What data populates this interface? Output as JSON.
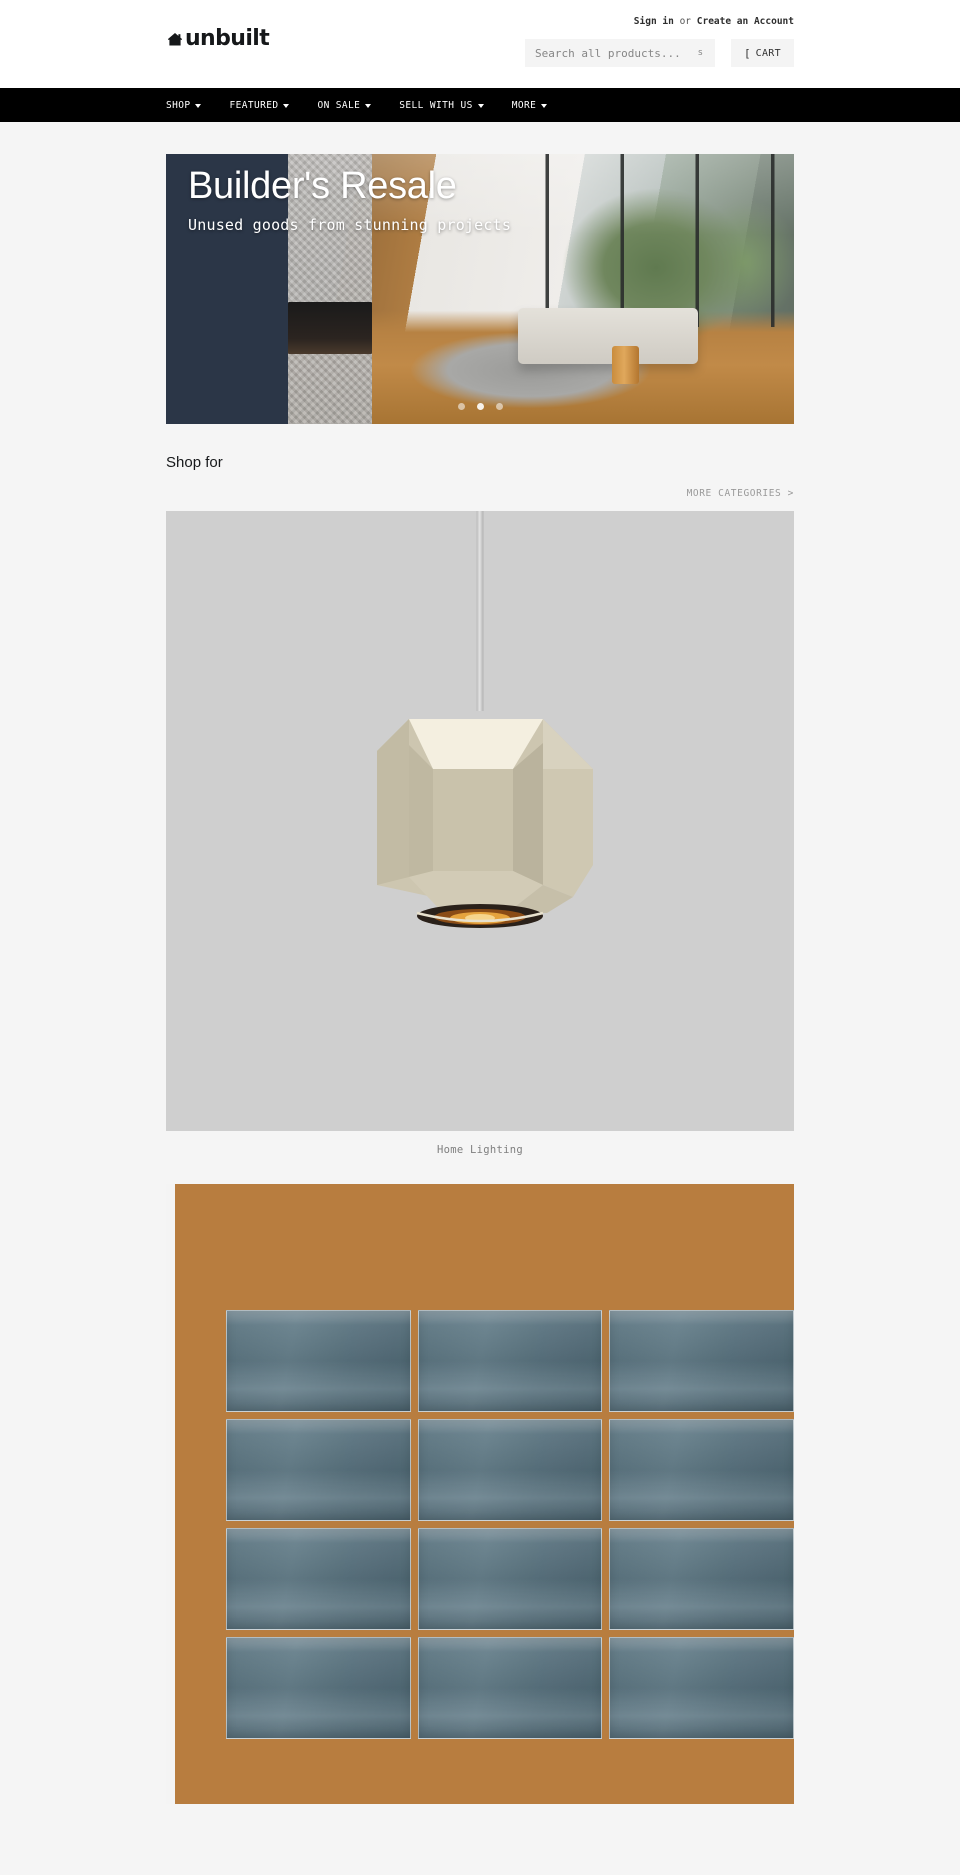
{
  "brand": {
    "name": "unbuilt",
    "logo_icon": "house-icon"
  },
  "account": {
    "sign_in": "Sign in",
    "separator": "or",
    "create_account": "Create an Account"
  },
  "search": {
    "placeholder": "Search all products...",
    "value": "",
    "submit_icon": "s"
  },
  "cart": {
    "icon": "[",
    "label": "CART"
  },
  "nav": {
    "items": [
      {
        "label": "SHOP",
        "caret": "chevron-down-icon"
      },
      {
        "label": "FEATURED",
        "caret": "chevron-down-icon"
      },
      {
        "label": "ON SALE",
        "caret": "chevron-down-icon"
      },
      {
        "label": "SELL WITH US",
        "caret": "chevron-down-icon"
      },
      {
        "label": "MORE",
        "caret": "chevron-down-icon"
      }
    ]
  },
  "hero": {
    "title": "Builder's Resale",
    "subtitle": "Unused goods from stunning projects",
    "overlay_color": "#2b3647",
    "slides": 3,
    "active_slide": 1
  },
  "shop_section": {
    "heading": "Shop for",
    "more_link": "MORE CATEGORIES >"
  },
  "categories": [
    {
      "caption": "Home Lighting",
      "media": "pendant-lamp-photo"
    },
    {
      "caption": "",
      "media": "blue-subway-tile-photo"
    }
  ],
  "colors": {
    "nav_background": "#000000",
    "page_background": "#f5f5f5",
    "hero_overlay": "#2b3647",
    "muted_text": "#9a9a9a",
    "tile_blue": "#5b7480",
    "lamp_cream": "#cfc6ac"
  }
}
